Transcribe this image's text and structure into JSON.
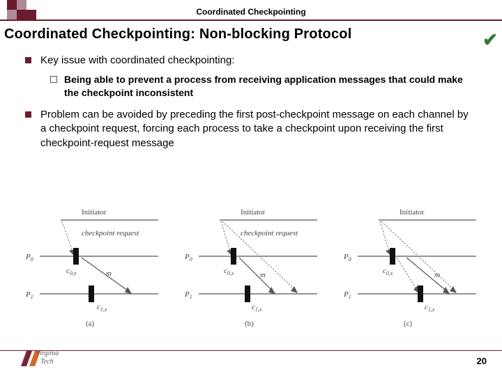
{
  "header": {
    "topic": "Coordinated Checkpointing",
    "title": "Coordinated Checkpointing: Non-blocking Protocol"
  },
  "bullets": {
    "b1a": "Key issue with coordinated checkpointing:",
    "b1a_sub": "Being able to prevent a process from receiving application messages that could make the checkpoint inconsistent",
    "b1b": "Problem can be avoided by preceding the first post-checkpoint message on each channel by a checkpoint request, forcing each process to take a checkpoint upon receiving the first checkpoint-request message"
  },
  "labels": {
    "initiator": "Initiator",
    "checkpoint_request": "checkpoint request",
    "m": "m",
    "p0": "P",
    "p0_sub": "0",
    "p1": "P",
    "p1_sub": "1",
    "c0": "c",
    "c0_sub": "0,x",
    "c1": "c",
    "c1_sub": "1,x",
    "fig_a": "(a)",
    "fig_b": "(b)",
    "fig_c": "(c)"
  },
  "footer": {
    "page": "20"
  }
}
